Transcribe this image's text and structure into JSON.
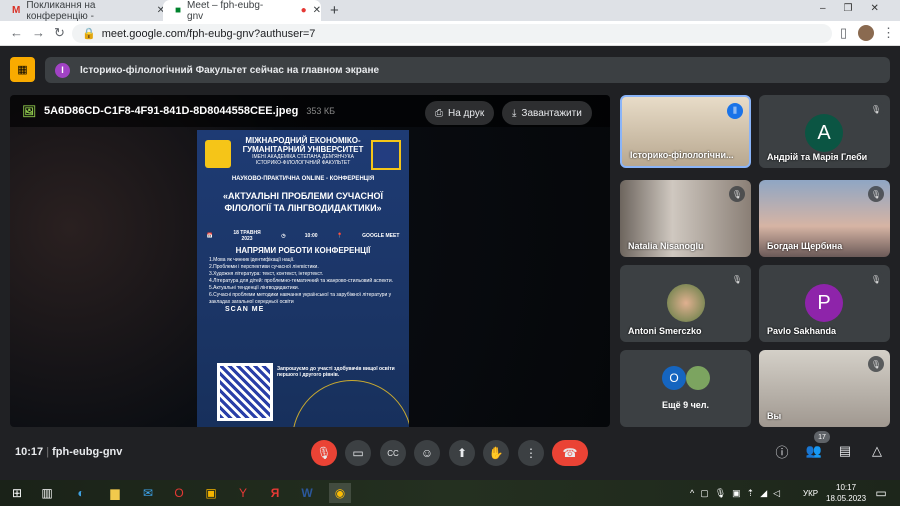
{
  "browser": {
    "tabs": [
      {
        "label": "Покликання на конференцію -"
      },
      {
        "label": "Meet – fph-eubg-gnv"
      }
    ],
    "url": "meet.google.com/fph-eubg-gnv?authuser=7"
  },
  "banner": {
    "avatar_letter": "І",
    "text": "Історико-філологічний Факультет сейчас на главном экране"
  },
  "viewer": {
    "filename": "5A6D86CD-C1F8-4F91-841D-8D8044558CEE.jpeg",
    "filesize": "353 КБ",
    "print_label": "На друк",
    "download_label": "Завантажити"
  },
  "poster": {
    "uni1": "МІЖНАРОДНИЙ ЕКОНОМІКО-",
    "uni2": "ГУМАНІТАРНИЙ УНІВЕРСИТЕТ",
    "uni3": "ІМЕНІ АКАДЕМІКА СТЕПАНА ДЕМ'ЯНЧУКА",
    "uni4": "ІСТОРИКО-ФІЛОЛОГІЧНИЙ ФАКУЛЬТЕТ",
    "conf": "НАУКОВО-ПРАКТИЧНА ONLINE - КОНФЕРЕНЦІЯ",
    "title": "«АКТУАЛЬНІ ПРОБЛЕМИ СУЧАСНОЇ ФІЛОЛОГІЇ ТА ЛІНГВОДИДАКТИКИ»",
    "date": "18 ТРАВНЯ 2023",
    "time": "10:00",
    "place": "GOOGLE MEET",
    "dir_title": "НАПРЯМИ РОБОТИ КОНФЕРЕНЦІЇ",
    "items": [
      "1.Мова як чинник ідентифікації нації.",
      "2.Проблеми і перспективи сучасної лінгвістики.",
      "3.Художня література: текст, контекст, інтертекст.",
      "4.Література для дітей: проблемно-тематичний та жанрово-стильовий аспекти.",
      "5.Актуальні тенденції лінгводидактики.",
      "6.Сучасні проблеми методики навчання української та зарубіжної літератури у закладах загальної середньої освіти"
    ],
    "scan": "SCAN ME",
    "invite": "Запрошуємо до участі здобувачів вищої освіти першого і другого рівнів."
  },
  "participants": [
    {
      "name": "Історико-філологічни...",
      "speaking": true
    },
    {
      "name": "Андрій та Марія Глеби",
      "letter": "А",
      "color": "#0b5543"
    },
    {
      "name": "Natalia Nisanoglu"
    },
    {
      "name": "Богдан Щербина"
    },
    {
      "name": "Antoni Smerczko"
    },
    {
      "name": "Pavlo Sakhanda",
      "letter": "P",
      "color": "#8e24aa"
    },
    {
      "name": "Ещё 9 чел.",
      "letter": "O"
    },
    {
      "name": "Вы"
    }
  ],
  "bottom": {
    "time": "10:17",
    "code": "fph-eubg-gnv",
    "people_count": "17"
  },
  "taskbar": {
    "lang": "УКР",
    "time": "10:17",
    "date": "18.05.2023"
  }
}
